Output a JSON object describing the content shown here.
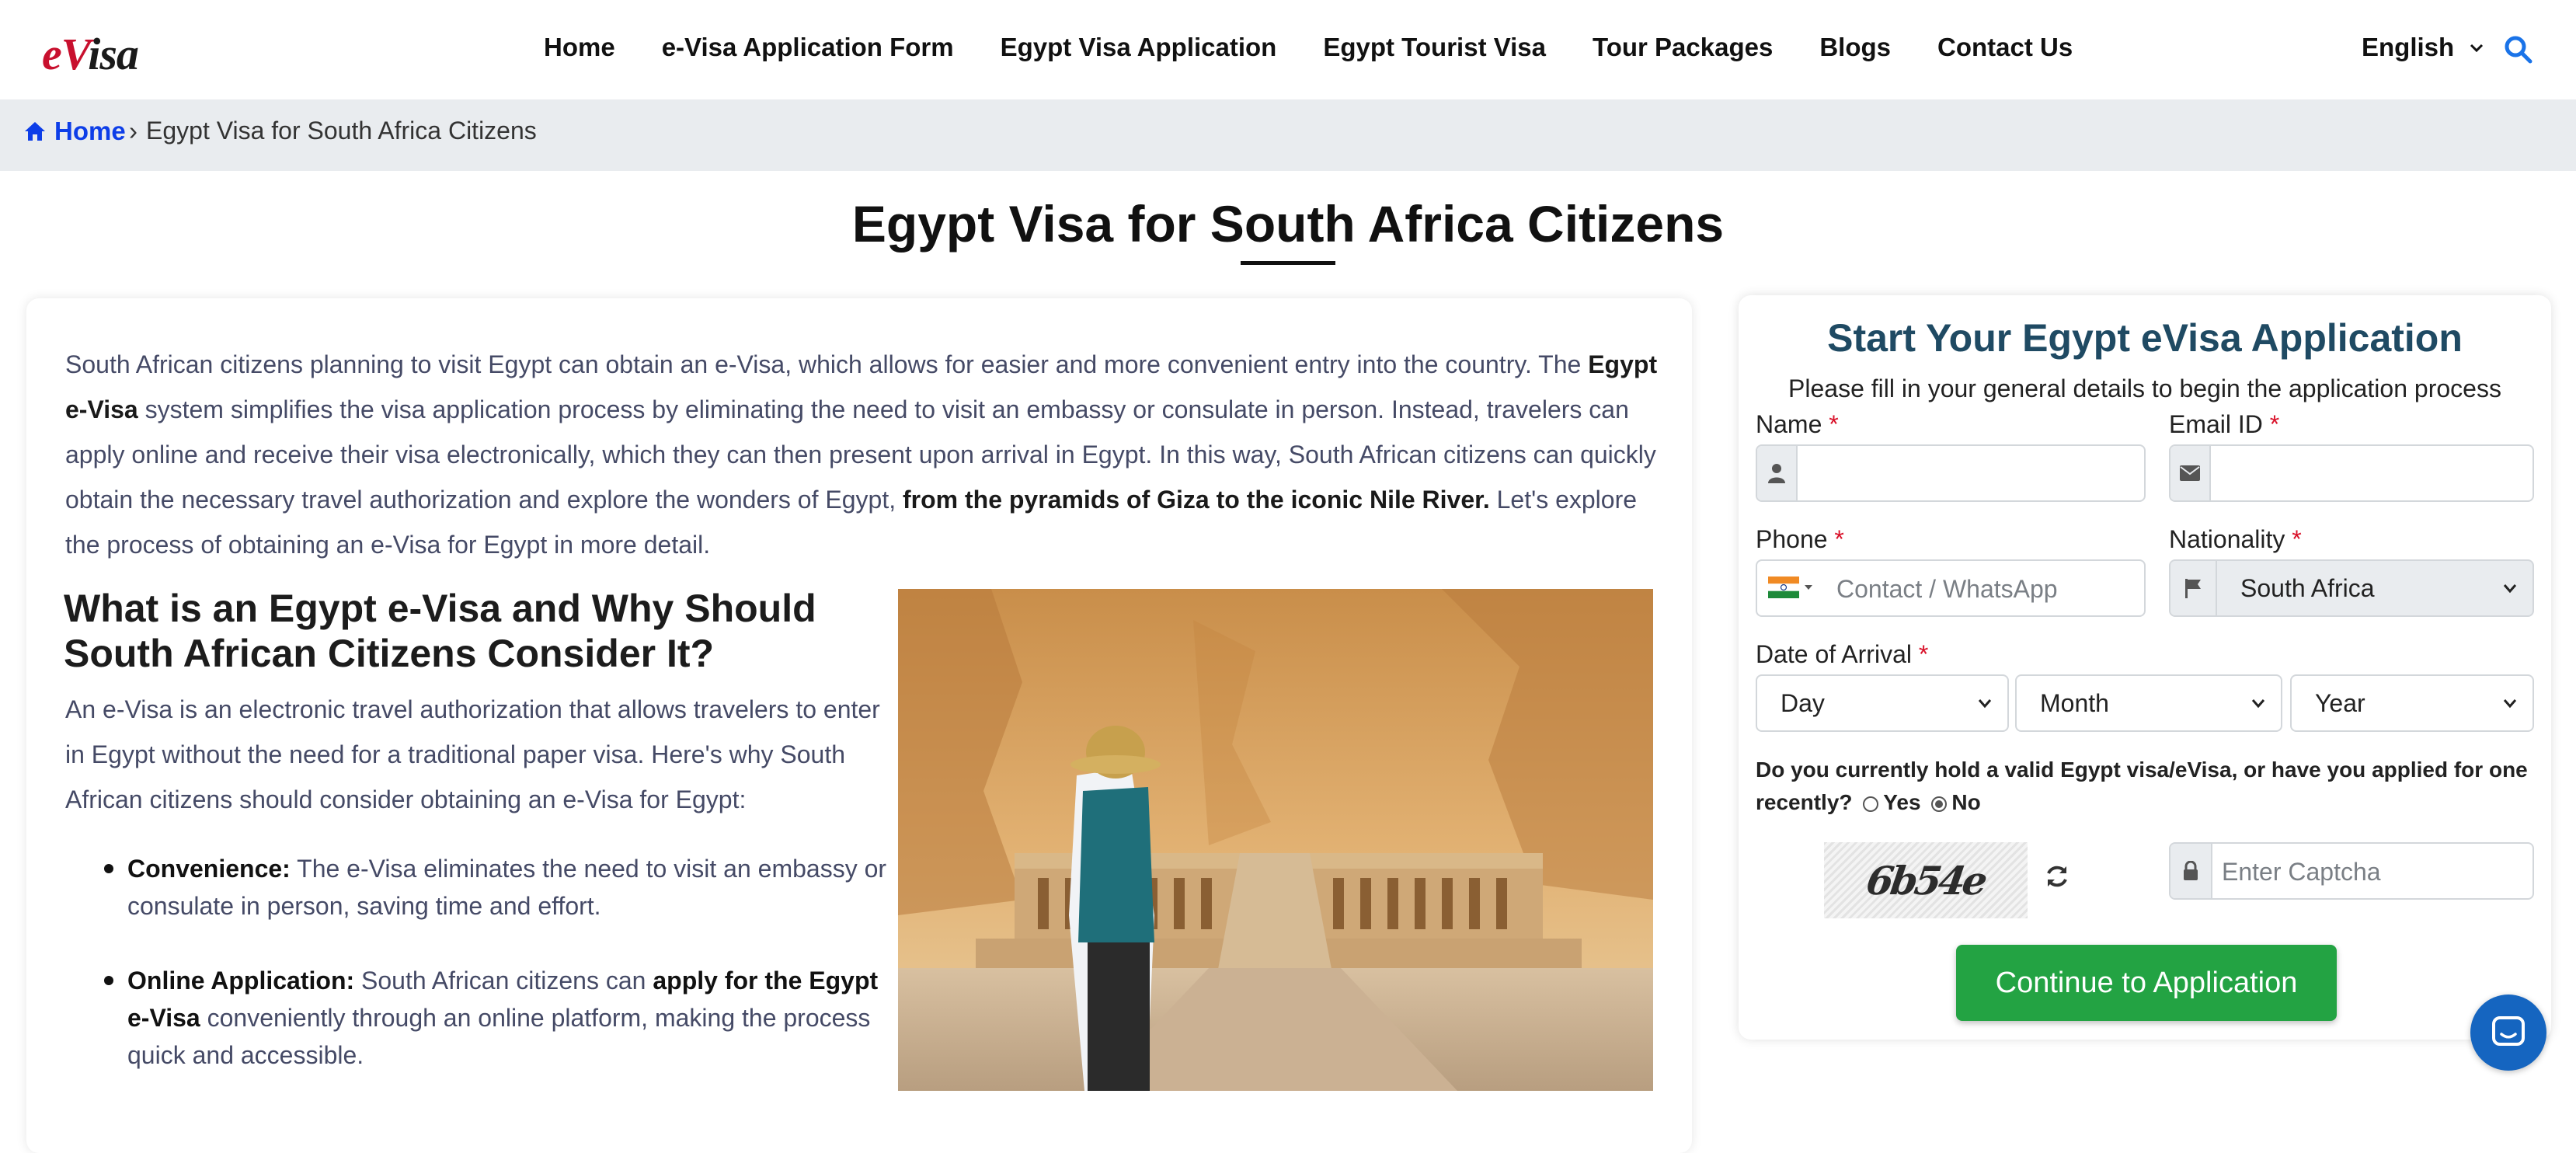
{
  "header": {
    "logo": {
      "e": "e",
      "v": "V",
      "rest": "isa"
    },
    "nav": [
      "Home",
      "e-Visa Application Form",
      "Egypt Visa Application",
      "Egypt Tourist Visa",
      "Tour Packages",
      "Blogs",
      "Contact Us"
    ],
    "language": "English"
  },
  "breadcrumb": {
    "home": "Home",
    "separator": "›",
    "current": "Egypt Visa for South Africa Citizens"
  },
  "page_title": "Egypt Visa for South Africa Citizens",
  "intro": {
    "p1": "South African citizens planning to visit Egypt can obtain an e-Visa, which allows for easier and more convenient entry into the country. The ",
    "b1": "Egypt e-Visa",
    "p2": " system simplifies the visa application process by eliminating the need to visit an embassy or consulate in person. Instead, travelers can apply online and receive their visa electronically, which they can then present upon arrival in Egypt. In this way, South African citizens can quickly obtain the necessary travel authorization and explore the wonders of Egypt, ",
    "b2": "from the pyramids of Giza to the iconic Nile River.",
    "p3": " Let's explore the process of obtaining an e-Visa for Egypt in more detail."
  },
  "section": {
    "heading": "What is an Egypt e-Visa and Why Should South African Citizens Consider It?",
    "para": "An e-Visa is an electronic travel authorization that allows travelers to enter in Egypt without the need for a traditional paper visa. Here's why South African citizens should consider obtaining an e-Visa for Egypt:",
    "bullets": [
      {
        "bold": "Convenience:",
        "text": " The e-Visa eliminates the need to visit an embassy or consulate in person, saving time and effort."
      },
      {
        "bold": "Online Application:",
        "text": " South African citizens can ",
        "bold2": "apply for the Egypt e-Visa",
        "text2": " conveniently through an online platform, making the process quick and accessible."
      }
    ]
  },
  "form": {
    "title": "Start Your Egypt eVisa Application",
    "subtitle": "Please fill in your general details to begin the application process",
    "name_label": "Name",
    "email_label": "Email ID",
    "phone_label": "Phone",
    "phone_placeholder": "Contact / WhatsApp",
    "nationality_label": "Nationality",
    "nationality_value": "South Africa",
    "arrival_label": "Date of Arrival",
    "day": "Day",
    "month": "Month",
    "year": "Year",
    "required_mark": "*",
    "question": "Do you currently hold a valid Egypt visa/eVisa, or have you applied for one recently?",
    "yes": "Yes",
    "no": "No",
    "selected_answer": "No",
    "captcha_text": "6b54e",
    "captcha_placeholder": "Enter Captcha",
    "submit": "Continue to Application"
  },
  "colors": {
    "brand_red": "#c8102e",
    "link_blue": "#0d3ee8",
    "form_title": "#1f4a63",
    "button_green": "#23a343",
    "chat_blue": "#1565c0"
  },
  "icons": [
    "home-icon",
    "search-icon",
    "chevron-down-icon",
    "user-icon",
    "envelope-icon",
    "flag-icon",
    "lock-icon",
    "refresh-icon",
    "chat-icon",
    "india-flag-icon"
  ]
}
